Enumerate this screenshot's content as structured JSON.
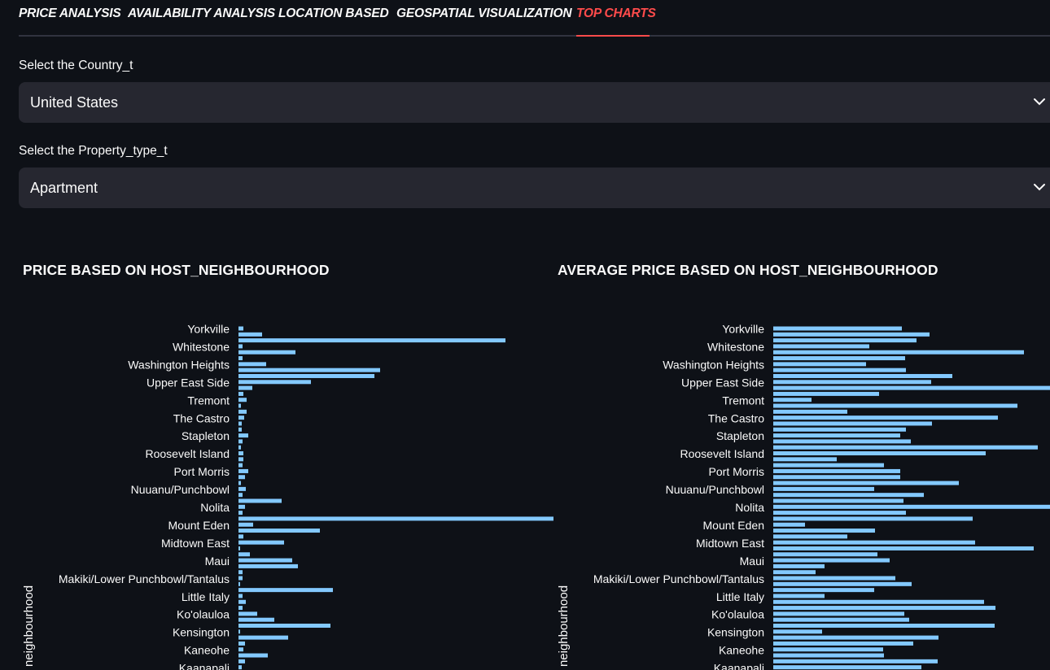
{
  "tabs": [
    {
      "label": "PRICE ANALYSIS",
      "active": false
    },
    {
      "label": "AVAILABILITY ANALYSIS",
      "active": false
    },
    {
      "label": "LOCATION BASED",
      "active": false
    },
    {
      "label": "GEOSPATIAL VISUALIZATION",
      "active": false
    },
    {
      "label": "TOP CHARTS",
      "active": true
    }
  ],
  "filters": {
    "country": {
      "label": "Select the Country_t",
      "value": "United States"
    },
    "property_type": {
      "label": "Select the Property_type_t",
      "value": "Apartment"
    }
  },
  "colors": {
    "accent": "#ff4b4b",
    "bar": "#83c9ff",
    "background": "#0e1117",
    "select_bg": "#262730"
  },
  "chart_data": [
    {
      "type": "bar",
      "orientation": "horizontal",
      "title": "PRICE BASED ON HOST_NEIGHBOURHOOD",
      "ylabel": "neighbourhood",
      "tick_labels": [
        "Yorkville",
        "Whitestone",
        "Washington Heights",
        "Upper East Side",
        "Tremont",
        "The Castro",
        "Stapleton",
        "Roosevelt Island",
        "Port Morris",
        "Nuuanu/Punchbowl",
        "Nolita",
        "Mount Eden",
        "Midtown East",
        "Maui",
        "Makiki/Lower Punchbowl/Tantalus",
        "Little Italy",
        "Ko'olauloa",
        "Kensington",
        "Kaneohe",
        "Kaanapali"
      ],
      "values": [
        6,
        29,
        328,
        5,
        70,
        5,
        34,
        174,
        167,
        89,
        17,
        6,
        10,
        3,
        10,
        7,
        4,
        4,
        12,
        5,
        3,
        6,
        6,
        5,
        12,
        8,
        3,
        9,
        5,
        53,
        8,
        5,
        387,
        18,
        100,
        6,
        56,
        2,
        14,
        66,
        73,
        5,
        5,
        2,
        116,
        5,
        9,
        5,
        23,
        44,
        113,
        2,
        61,
        8,
        6,
        36,
        8,
        4
      ]
    },
    {
      "type": "bar",
      "orientation": "horizontal",
      "title": "AVERAGE PRICE BASED ON HOST_NEIGHBOURHOOD",
      "ylabel": "neighbourhood",
      "tick_labels": [
        "Yorkville",
        "Whitestone",
        "Washington Heights",
        "Upper East Side",
        "Tremont",
        "The Castro",
        "Stapleton",
        "Roosevelt Island",
        "Port Morris",
        "Nuuanu/Punchbowl",
        "Nolita",
        "Mount Eden",
        "Midtown East",
        "Maui",
        "Makiki/Lower Punchbowl/Tantalus",
        "Little Italy",
        "Ko'olauloa",
        "Kensington",
        "Kaneohe",
        "Kaanapali"
      ],
      "values": [
        158,
        192,
        176,
        118,
        308,
        162,
        114,
        163,
        220,
        194,
        345,
        130,
        47,
        300,
        91,
        276,
        195,
        163,
        156,
        169,
        325,
        261,
        78,
        136,
        156,
        156,
        228,
        124,
        185,
        160,
        355,
        163,
        245,
        39,
        125,
        91,
        248,
        320,
        128,
        143,
        63,
        52,
        150,
        170,
        124,
        63,
        259,
        273,
        161,
        167,
        272,
        60,
        203,
        172,
        135,
        136,
        202,
        182
      ]
    }
  ]
}
